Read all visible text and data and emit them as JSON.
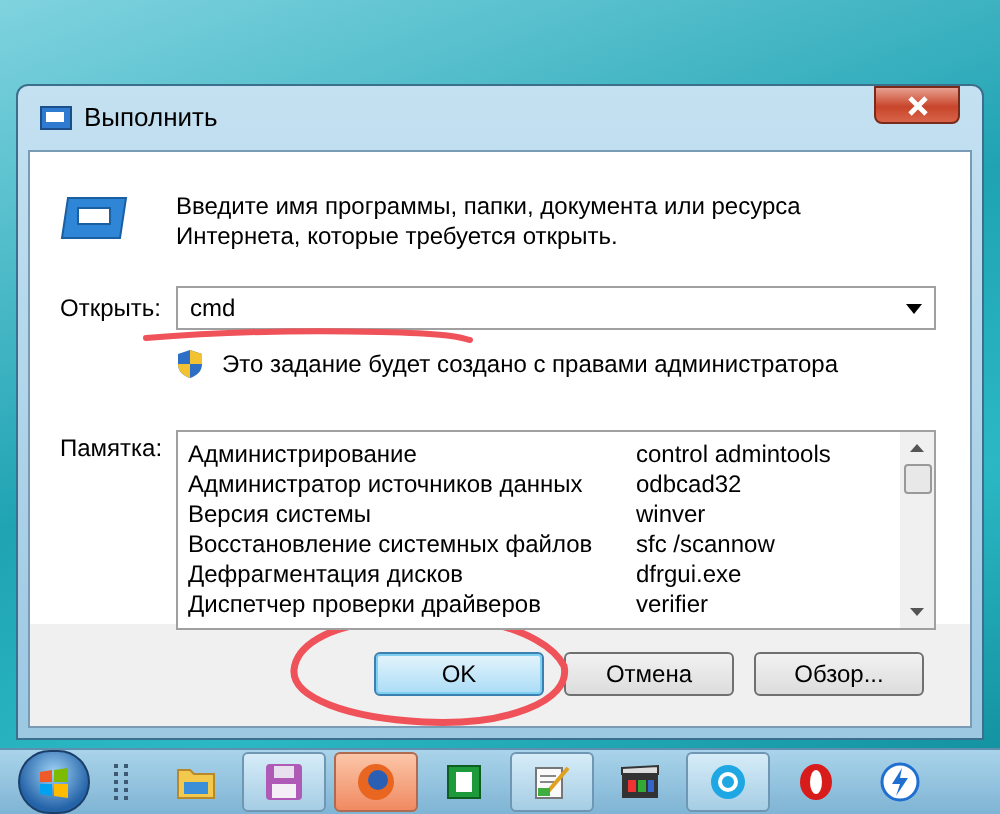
{
  "window": {
    "title": "Выполнить"
  },
  "description_lines": [
    "Введите имя программы, папки, документа или ресурса",
    "Интернета, которые требуется открыть."
  ],
  "open": {
    "label": "Открыть:",
    "value": "cmd"
  },
  "admin_note": "Это задание будет создано с правами администратора",
  "memo": {
    "label": "Памятка:",
    "rows": [
      {
        "name": "Администрирование",
        "command": "control admintools"
      },
      {
        "name": "Администратор источников данных",
        "command": "odbcad32"
      },
      {
        "name": "Версия системы",
        "command": "winver"
      },
      {
        "name": "Восстановление системных файлов",
        "command": "sfc /scannow"
      },
      {
        "name": "Дефрагментация дисков",
        "command": "dfrgui.exe"
      },
      {
        "name": "Диспетчер проверки драйверов",
        "command": "verifier"
      }
    ]
  },
  "buttons": [
    {
      "label": "OK",
      "default": true
    },
    {
      "label": "Отмена",
      "default": false
    },
    {
      "label": "Обзор...",
      "default": false
    }
  ],
  "taskbar": [
    {
      "kind": "folder",
      "running": false,
      "selected": false
    },
    {
      "kind": "floppy",
      "running": true,
      "selected": false
    },
    {
      "kind": "globe",
      "running": true,
      "selected": true
    },
    {
      "kind": "tile",
      "running": false,
      "selected": false
    },
    {
      "kind": "notepad",
      "running": true,
      "selected": false
    },
    {
      "kind": "clapper",
      "running": false,
      "selected": false
    },
    {
      "kind": "bubble",
      "running": true,
      "selected": false
    },
    {
      "kind": "ring",
      "running": false,
      "selected": false
    },
    {
      "kind": "bolt",
      "running": false,
      "selected": false
    }
  ]
}
